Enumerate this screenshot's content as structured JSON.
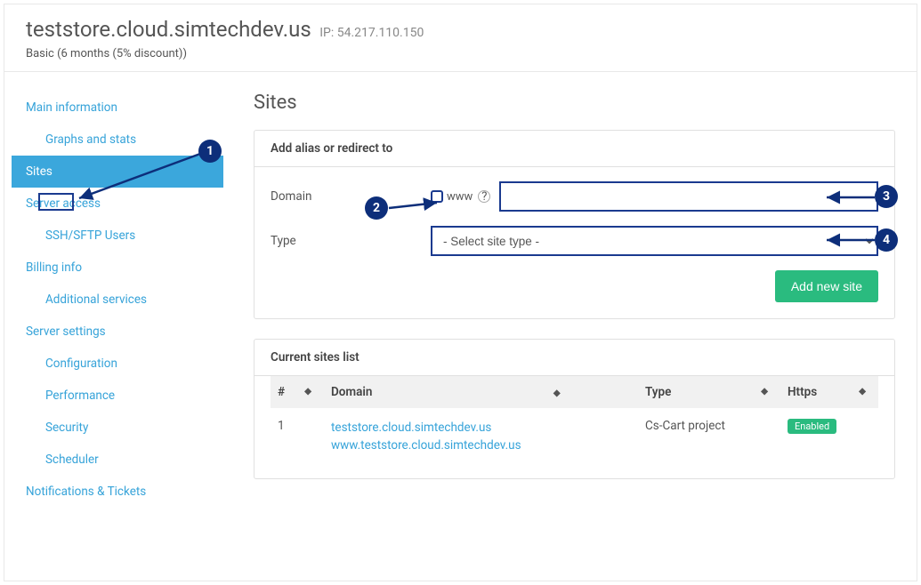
{
  "header": {
    "title": "teststore.cloud.simtechdev.us",
    "ip_label": "IP:",
    "ip": "54.217.110.150",
    "plan": "Basic (6 months (5% discount))"
  },
  "sidebar": {
    "items": [
      {
        "label": "Main information",
        "sub": false,
        "active": false
      },
      {
        "label": "Graphs and stats",
        "sub": true,
        "active": false
      },
      {
        "label": "Sites",
        "sub": false,
        "active": true
      },
      {
        "label": "Server access",
        "sub": false,
        "active": false
      },
      {
        "label": "SSH/SFTP Users",
        "sub": true,
        "active": false
      },
      {
        "label": "Billing info",
        "sub": false,
        "active": false
      },
      {
        "label": "Additional services",
        "sub": true,
        "active": false
      },
      {
        "label": "Server settings",
        "sub": false,
        "active": false
      },
      {
        "label": "Configuration",
        "sub": true,
        "active": false
      },
      {
        "label": "Performance",
        "sub": true,
        "active": false
      },
      {
        "label": "Security",
        "sub": true,
        "active": false
      },
      {
        "label": "Scheduler",
        "sub": true,
        "active": false
      },
      {
        "label": "Notifications & Tickets",
        "sub": false,
        "active": false
      }
    ]
  },
  "main": {
    "heading": "Sites",
    "panel1": {
      "title": "Add alias or redirect to",
      "domain_label": "Domain",
      "www_label": "www",
      "type_label": "Type",
      "type_placeholder": "- Select site type -",
      "add_button": "Add new site"
    },
    "panel2": {
      "title": "Current sites list",
      "columns": {
        "num": "#",
        "domain": "Domain",
        "type": "Type",
        "https": "Https"
      },
      "rows": [
        {
          "num": "1",
          "domains": [
            "teststore.cloud.simtechdev.us",
            "www.teststore.cloud.simtechdev.us"
          ],
          "type": "Cs-Cart project",
          "https": "Enabled"
        }
      ]
    }
  },
  "annotations": {
    "a1": "1",
    "a2": "2",
    "a3": "3",
    "a4": "4"
  }
}
